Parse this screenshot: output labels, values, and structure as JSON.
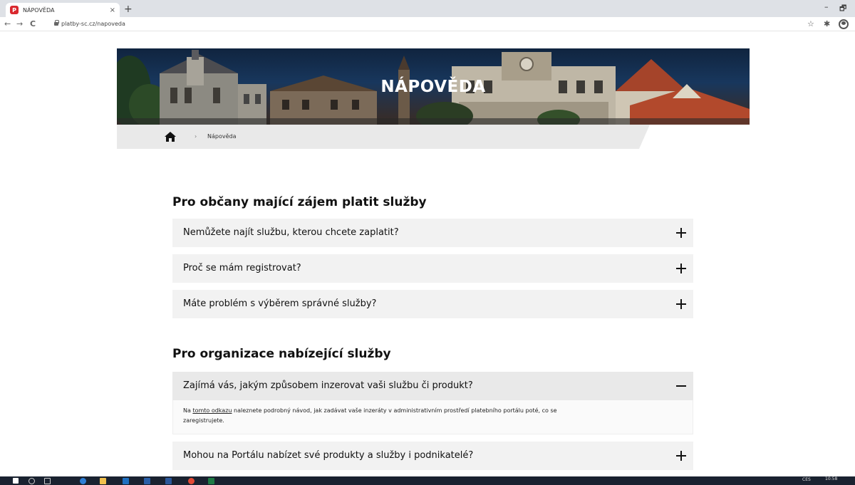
{
  "browser": {
    "tab_title": "NÁPOVĚDA",
    "favicon_letter": "P",
    "close_glyph": "×",
    "new_tab_glyph": "+",
    "url": "platby-sc.cz/napoveda",
    "minimize_glyph": "–",
    "restore_glyph": "🗗",
    "back_glyph": "←",
    "forward_glyph": "→",
    "reload_glyph": "C",
    "bookmark_glyph": "☆",
    "extensions_glyph": "✱"
  },
  "hero": {
    "title": "NÁPOVĚDA"
  },
  "breadcrumb": {
    "separator": "›",
    "current": "Nápověda"
  },
  "sections": [
    {
      "title": "Pro občany mající zájem platit služby",
      "items": [
        {
          "question": "Nemůžete najít službu, kterou chcete zaplatit?",
          "state": "collapsed"
        },
        {
          "question": "Proč se mám registrovat?",
          "state": "collapsed"
        },
        {
          "question": "Máte problém s výběrem správné služby?",
          "state": "collapsed"
        }
      ]
    },
    {
      "title": "Pro organizace nabízející služby",
      "items": [
        {
          "question": "Zajímá vás, jakým způsobem inzerovat vaši službu či produkt?",
          "state": "expanded",
          "answer_prefix": "Na ",
          "answer_link": "tomto odkazu",
          "answer_line1": " naleznete podrobný návod, jak zadávat vaše inzeráty v administrativním prostředí platebního portálu poté, co se",
          "answer_line2": "zaregistrujete."
        },
        {
          "question": "Mohou na Portálu nabízet své produkty a služby i podnikatelé?",
          "state": "collapsed"
        }
      ]
    }
  ],
  "taskbar": {
    "language": "CES",
    "time": "10:58"
  },
  "colors": {
    "accordion_bg": "#f2f2f2",
    "accordion_open_bg": "#e9e9e9",
    "favicon": "#d9282e",
    "hero_sky": "#18375d"
  }
}
